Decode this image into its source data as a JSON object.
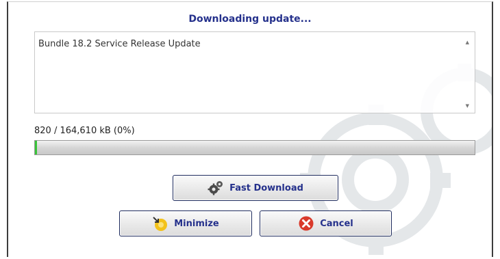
{
  "dialog": {
    "title": "Downloading update..."
  },
  "details": {
    "text": "Bundle 18.2 Service Release Update"
  },
  "progress": {
    "text": "820 / 164,610 kB (0%)",
    "downloaded_kb": 820,
    "total_kb": 164610,
    "percent": 0,
    "bar_color": "#3ac33a"
  },
  "buttons": {
    "fast_download": {
      "label": "Fast Download",
      "icon": "gears-icon"
    },
    "minimize": {
      "label": "Minimize",
      "icon": "minimize-icon"
    },
    "cancel": {
      "label": "Cancel",
      "icon": "cancel-x-icon"
    }
  },
  "colors": {
    "accent": "#25318c",
    "cancel_red": "#d93a2b"
  }
}
